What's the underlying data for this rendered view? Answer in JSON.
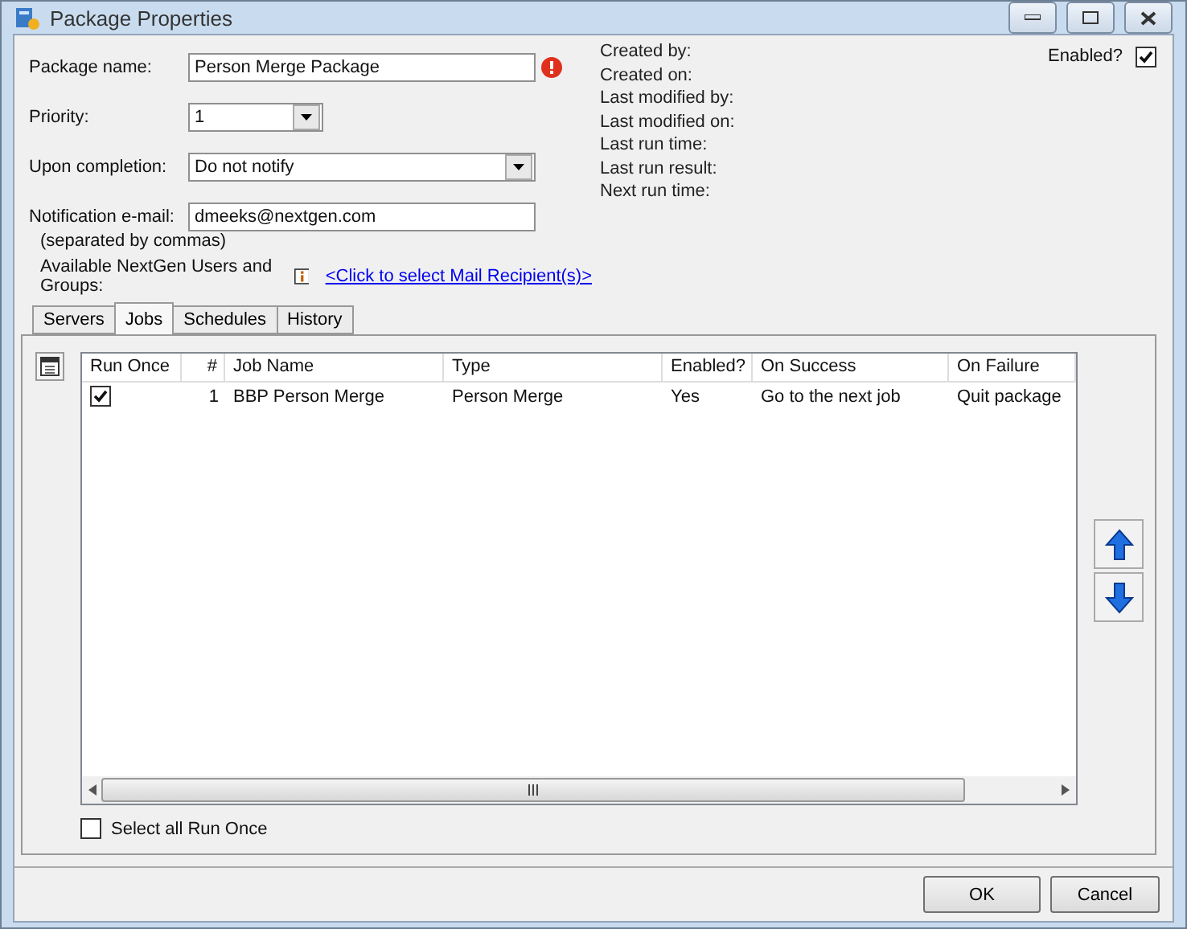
{
  "window": {
    "title": "Package Properties"
  },
  "form": {
    "fields": [
      {
        "kind": "text",
        "label": "Package name:",
        "value": "Person Merge Package",
        "error": true
      },
      {
        "kind": "dropdown",
        "label": "Priority:",
        "value": "1",
        "error": false
      },
      {
        "kind": "dropdown",
        "label": "Upon completion:",
        "value": "Do not notify",
        "error": false
      },
      {
        "kind": "text",
        "label": "Notification e-mail:",
        "value": "dmeeks@nextgen.com",
        "error": false
      }
    ],
    "hint": "(separated by commas)",
    "recipients_label": "Available NextGen Users and Groups:",
    "recipients_link": "<Click to select Mail Recipient(s)>"
  },
  "info": [
    "Created by:",
    "Created on:",
    "Last modified by:",
    "Last modified on:",
    "Last run time:",
    "Last run result:",
    "Next run time:"
  ],
  "enabled": {
    "label": "Enabled?",
    "checked": true
  },
  "tabs": [
    {
      "label": "Servers",
      "selected": false
    },
    {
      "label": "Jobs",
      "selected": true
    },
    {
      "label": "Schedules",
      "selected": false
    },
    {
      "label": "History",
      "selected": false
    }
  ],
  "table": {
    "columns": [
      "Run Once",
      "#",
      "Job Name",
      "Type",
      "Enabled?",
      "On Success",
      "On Failure"
    ],
    "rows": [
      {
        "run_once": true,
        "cells": [
          "",
          "1",
          "BBP Person Merge",
          "Person Merge",
          "Yes",
          "Go to the next job",
          "Quit package"
        ]
      }
    ]
  },
  "select_all": {
    "label": "Select all Run Once",
    "checked": false
  },
  "buttons": [
    "OK",
    "Cancel"
  ]
}
